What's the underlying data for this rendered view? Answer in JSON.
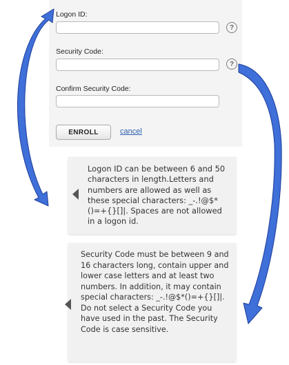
{
  "form": {
    "logon_label": "Logon ID:",
    "logon_value": "",
    "security_label": "Security Code:",
    "security_value": "",
    "confirm_label": "Confirm Security Code:",
    "confirm_value": "",
    "help_symbol": "?",
    "enroll_label": "ENROLL",
    "cancel_label": "cancel"
  },
  "tooltips": {
    "logon_help": "Logon ID can be between 6 and 50 characters in length.Letters and numbers are allowed as well as these special characters: _-.!@$*()=+{}[]|. Spaces are not allowed in a logon id.",
    "security_help": "Security Code must be between 9 and 16 characters long, contain upper and lower case letters and at least two numbers. In addition, it may contain special characters: _-.!@$*()=+{}[]|. Do not select a Security Code you have used in the past. The Security Code is case sensitive."
  },
  "colors": {
    "arrow_fill": "#3f6fd8",
    "arrow_stroke": "#1f3f9a",
    "link": "#2a5db0"
  },
  "icons": [
    "help-icon",
    "tooltip-pointer-icon",
    "curved-arrow-icon"
  ]
}
